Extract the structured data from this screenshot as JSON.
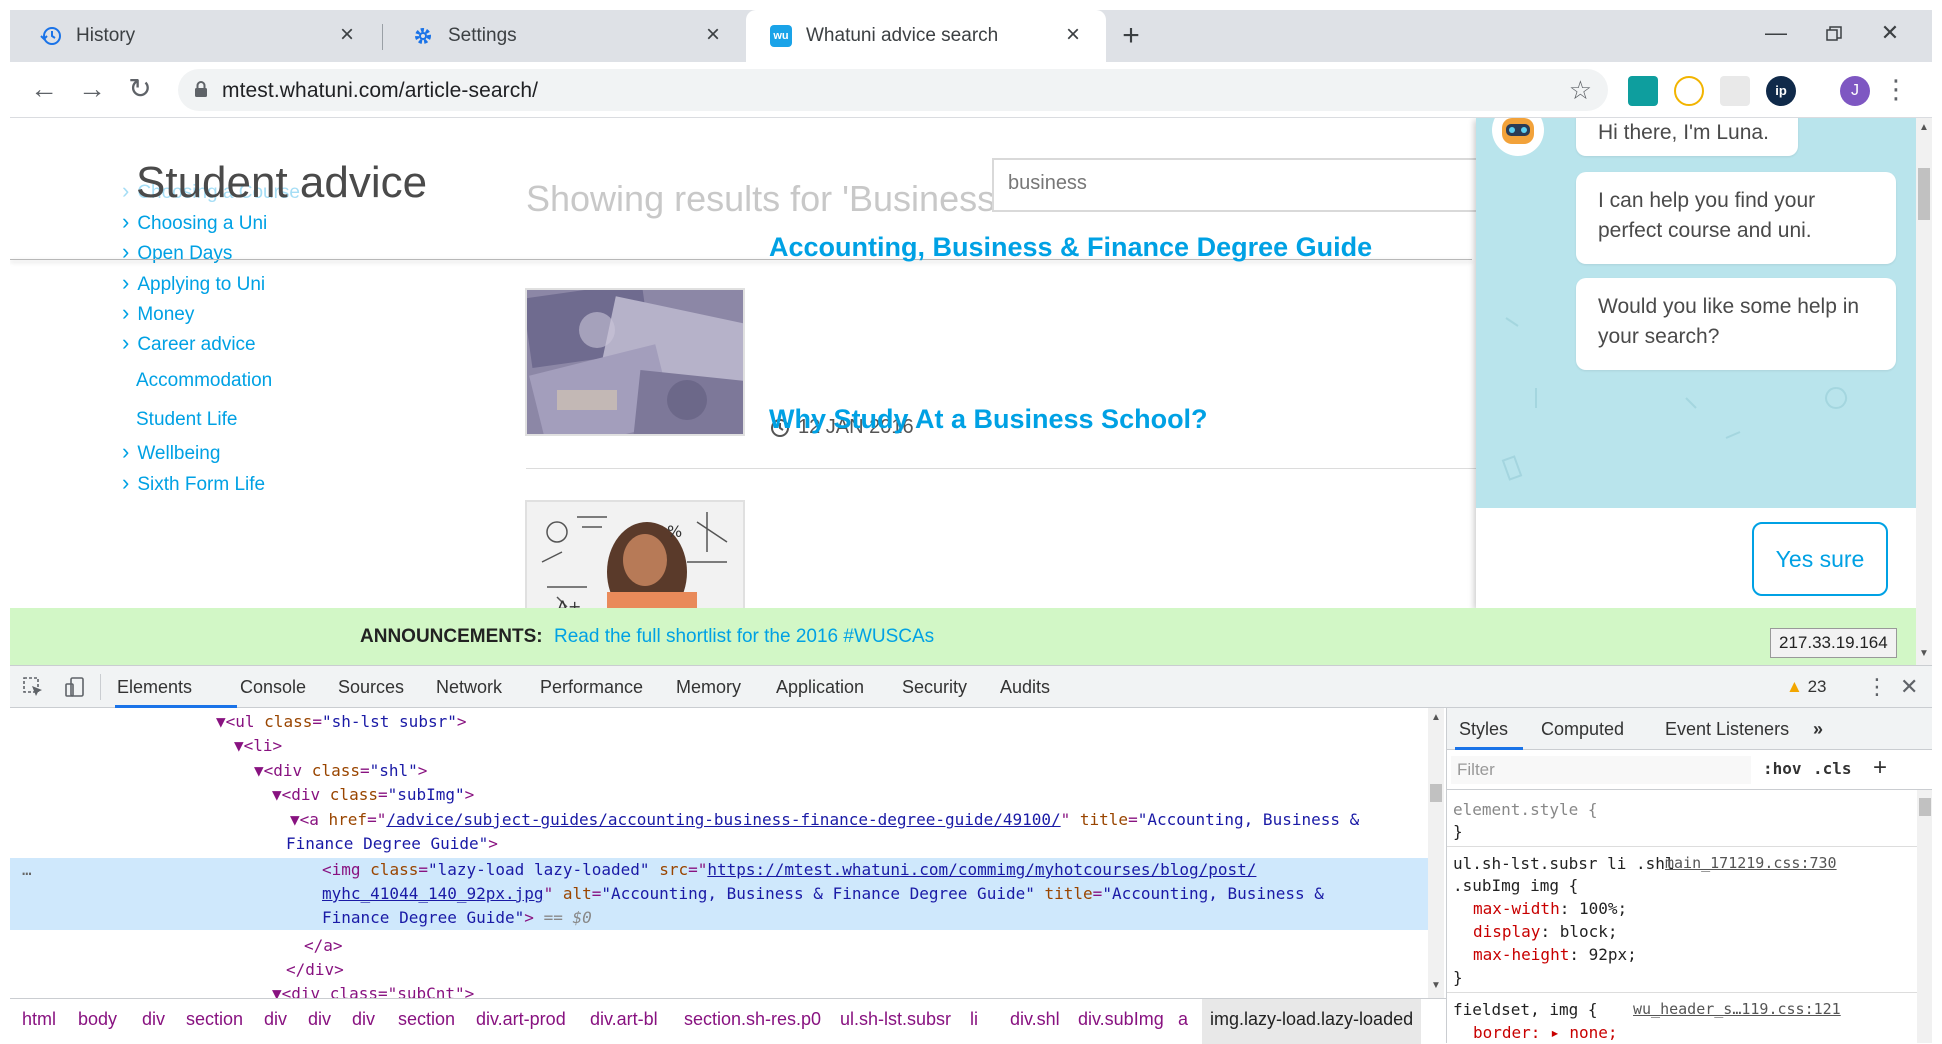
{
  "browser": {
    "tabs": [
      {
        "title": "History",
        "icon": "history-icon",
        "active": false
      },
      {
        "title": "Settings",
        "icon": "gear-icon",
        "active": false
      },
      {
        "title": "Whatuni advice search",
        "icon": "whatuni-favicon",
        "active": true
      }
    ],
    "url": "mtest.whatuni.com/article-search/",
    "profile_initial": "J",
    "profile_color": "#7e57c2"
  },
  "page": {
    "heading": "Student advice",
    "results_title": "Showing results for 'Business'",
    "search_value": "business",
    "sidebar": [
      {
        "label": "Choosing a Course",
        "sub": true
      },
      {
        "label": "Choosing a Uni",
        "sub": true
      },
      {
        "label": "Open Days",
        "sub": true
      },
      {
        "label": "Applying to Uni",
        "sub": true
      },
      {
        "label": "Money",
        "sub": true
      },
      {
        "label": "Career advice",
        "sub": true
      },
      {
        "label": "Accommodation",
        "sub": false
      },
      {
        "label": "Student Life",
        "sub": false
      },
      {
        "label": "Wellbeing",
        "sub": true
      },
      {
        "label": "Sixth Form Life",
        "sub": true
      }
    ],
    "articles": [
      {
        "title": "Accounting, Business & Finance Degree Guide",
        "date": "12 JAN 2016"
      },
      {
        "title": "Why Study At a Business School?"
      }
    ],
    "chat": {
      "messages": [
        "Hi there, I'm Luna.",
        "I can help you find your perfect course and uni.",
        "Would you like some help in your search?"
      ],
      "reply_button": "Yes sure"
    },
    "announcement": {
      "label": "ANNOUNCEMENTS:",
      "link": "Read the full shortlist for the 2016 #WUSCAs"
    },
    "ip_badge": "217.33.19.164",
    "accent_color": "#00a1e4"
  },
  "devtools": {
    "tabs": [
      "Elements",
      "Console",
      "Sources",
      "Network",
      "Performance",
      "Memory",
      "Application",
      "Security",
      "Audits"
    ],
    "warning_count": "23",
    "dom_lines": [
      {
        "tag_open": "<ul ",
        "attr": "class",
        "val": "\"sh-lst subsr\"",
        "close": ">"
      },
      {
        "text": "<li>"
      },
      {
        "tag_open": "<div ",
        "attr": "class",
        "val": "\"shl\"",
        "close": ">"
      },
      {
        "tag_open": "<div ",
        "attr": "class",
        "val": "\"subImg\"",
        "close": ">"
      }
    ],
    "a_href": "/advice/subject-guides/accounting-business-finance-degree-guide/49100/",
    "a_title": "\"Accounting, Business &",
    "a_title_2": "Finance Degree Guide\"",
    "img_class": "\"lazy-load lazy-loaded\"",
    "img_src_1": "https://mtest.whatuni.com/commimg/myhotcourses/blog/post/",
    "img_src_2": "myhc_41044_140_92px.jpg",
    "img_alt": "\"Accounting, Business & Finance Degree Guide\"",
    "img_title_1": "\"Accounting, Business &",
    "img_title_2": "Finance Degree Guide\"",
    "eq": "== $0",
    "close_a": "</a>",
    "close_div": "</div>",
    "next_div": "<div class=\"subCnt\">",
    "breadcrumbs": [
      "html",
      "body",
      "div",
      "section",
      "div",
      "div",
      "div",
      "section",
      "div.art-prod",
      "div.art-bl",
      "section.sh-res.p0",
      "ul.sh-lst.subsr",
      "li",
      "div.shl",
      "div.subImg",
      "a",
      "img.lazy-load.lazy-loaded"
    ],
    "styles": {
      "tabs": [
        "Styles",
        "Computed",
        "Event Listeners"
      ],
      "filter_placeholder": "Filter",
      "hov": ":hov",
      "cls": ".cls",
      "element_style": "element.style {",
      "close_brace": "}",
      "rule1_selector": "ul.sh-lst.subsr li .shl",
      "rule1_selector2": ".subImg img {",
      "rule1_source": "main_171219.css:730",
      "rule1_props": [
        {
          "name": "max-width",
          "value": "100%;"
        },
        {
          "name": "display",
          "value": "block;"
        },
        {
          "name": "max-height",
          "value": "92px;"
        }
      ],
      "rule2_selector": "fieldset, img {",
      "rule2_source": "wu_header_s…119.css:121",
      "rule2_prop": "border: ▸ none;"
    }
  }
}
